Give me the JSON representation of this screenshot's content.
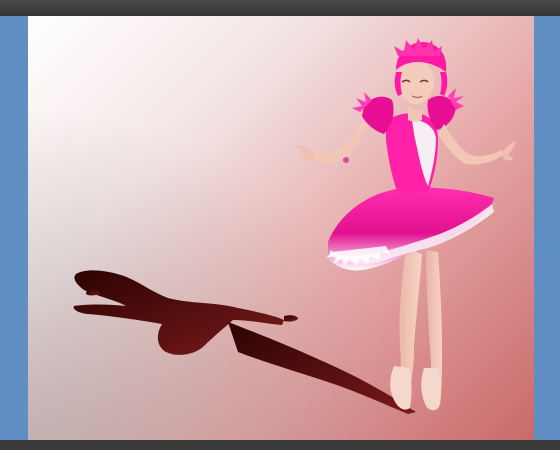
{
  "window": {
    "type": "image-editor-canvas"
  },
  "colors": {
    "pasteboard": "#5f8fc3",
    "chrome": "#3f3f3f",
    "canvas_light": "#ffffff",
    "canvas_accent": "#c86a6a",
    "shadow": "#5a0d0d",
    "costume_pink": "#ff1aa5",
    "costume_white": "#f4eef2",
    "skin": "#f2c7b6"
  },
  "canvas": {
    "content": "ballerina-with-cast-shadow"
  }
}
